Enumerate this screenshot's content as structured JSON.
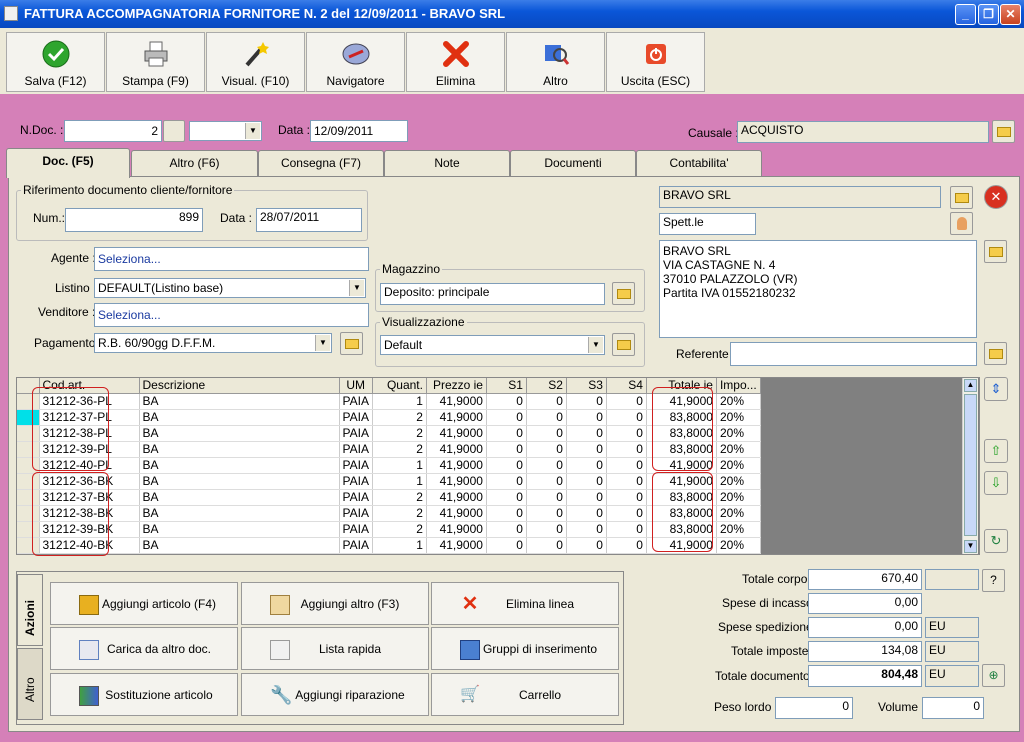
{
  "window": {
    "title": "FATTURA ACCOMPAGNATORIA FORNITORE N. 2  del 12/09/2011 - BRAVO SRL"
  },
  "toolbar": {
    "save": "Salva (F12)",
    "print": "Stampa (F9)",
    "visual": "Visual. (F10)",
    "nav": "Navigatore",
    "delete": "Elimina",
    "other": "Altro",
    "exit": "Uscita (ESC)"
  },
  "header": {
    "ndoc_label": "N.Doc. :",
    "ndoc": "2",
    "data_label": "Data :",
    "data": "12/09/2011",
    "causale_label": "Causale :",
    "causale": "ACQUISTO"
  },
  "tabs": [
    "Doc. (F5)",
    "Altro (F6)",
    "Consegna (F7)",
    "Note",
    "Documenti",
    "Contabilita'"
  ],
  "rif": {
    "legend": "Riferimento documento cliente/fornitore",
    "num_label": "Num.:",
    "num": "899",
    "data_label": "Data :",
    "data": "28/07/2011"
  },
  "fields": {
    "agente_label": "Agente :",
    "agente": "Seleziona...",
    "listino_label": "Listino :",
    "listino": "DEFAULT(Listino base)",
    "venditore_label": "Venditore :",
    "venditore": "Seleziona...",
    "pagamento_label": "Pagamento :",
    "pagamento": "R.B. 60/90gg D.F.F.M."
  },
  "magazzino": {
    "legend": "Magazzino",
    "value": "Deposito: principale"
  },
  "visualizzazione": {
    "legend": "Visualizzazione",
    "value": "Default"
  },
  "cliente": {
    "name": "BRAVO SRL",
    "spett": "Spett.le",
    "addr1": "BRAVO SRL",
    "addr2": "VIA CASTAGNE N. 4",
    "addr3": "37010 PALAZZOLO (VR)",
    "addr4": "Partita IVA 01552180232",
    "referente_label": "Referente"
  },
  "grid": {
    "headers": [
      "Cod.art.",
      "Descrizione",
      "UM",
      "Quant.",
      "Prezzo ie",
      "S1",
      "S2",
      "S3",
      "S4",
      "Totale ie",
      "Impo..."
    ],
    "rows": [
      [
        "31212-36-PL",
        "BA",
        "PAIA",
        "1",
        "41,9000",
        "0",
        "0",
        "0",
        "0",
        "41,9000",
        "20%"
      ],
      [
        "31212-37-PL",
        "BA",
        "PAIA",
        "2",
        "41,9000",
        "0",
        "0",
        "0",
        "0",
        "83,8000",
        "20%"
      ],
      [
        "31212-38-PL",
        "BA",
        "PAIA",
        "2",
        "41,9000",
        "0",
        "0",
        "0",
        "0",
        "83,8000",
        "20%"
      ],
      [
        "31212-39-PL",
        "BA",
        "PAIA",
        "2",
        "41,9000",
        "0",
        "0",
        "0",
        "0",
        "83,8000",
        "20%"
      ],
      [
        "31212-40-PL",
        "BA",
        "PAIA",
        "1",
        "41,9000",
        "0",
        "0",
        "0",
        "0",
        "41,9000",
        "20%"
      ],
      [
        "31212-36-BK",
        "BA",
        "PAIA",
        "1",
        "41,9000",
        "0",
        "0",
        "0",
        "0",
        "41,9000",
        "20%"
      ],
      [
        "31212-37-BK",
        "BA",
        "PAIA",
        "2",
        "41,9000",
        "0",
        "0",
        "0",
        "0",
        "83,8000",
        "20%"
      ],
      [
        "31212-38-BK",
        "BA",
        "PAIA",
        "2",
        "41,9000",
        "0",
        "0",
        "0",
        "0",
        "83,8000",
        "20%"
      ],
      [
        "31212-39-BK",
        "BA",
        "PAIA",
        "2",
        "41,9000",
        "0",
        "0",
        "0",
        "0",
        "83,8000",
        "20%"
      ],
      [
        "31212-40-BK",
        "BA",
        "PAIA",
        "1",
        "41,9000",
        "0",
        "0",
        "0",
        "0",
        "41,9000",
        "20%"
      ]
    ]
  },
  "actions": {
    "tab1": "Azioni",
    "tab2": "Altro",
    "b1": "Aggiungi articolo (F4)",
    "b2": "Aggiungi altro (F3)",
    "b3": "Elimina linea",
    "b4": "Carica da altro doc.",
    "b5": "Lista rapida",
    "b6": "Gruppi di inserimento",
    "b7": "Sostituzione articolo",
    "b8": "Aggiungi riparazione",
    "b9": "Carrello"
  },
  "totals": {
    "corpo_label": "Totale corpo :",
    "corpo": "670,40",
    "incasso_label": "Spese di incasso :",
    "incasso": "0,00",
    "spedizione_label": "Spese spedizione :",
    "spedizione": "0,00",
    "imposte_label": "Totale imposte :",
    "imposte": "134,08",
    "documento_label": "Totale documento :",
    "documento": "804,48",
    "eu": "EU",
    "help": "?",
    "peso_label": "Peso lordo :",
    "peso": "0",
    "volume_label": "Volume :",
    "volume": "0"
  }
}
